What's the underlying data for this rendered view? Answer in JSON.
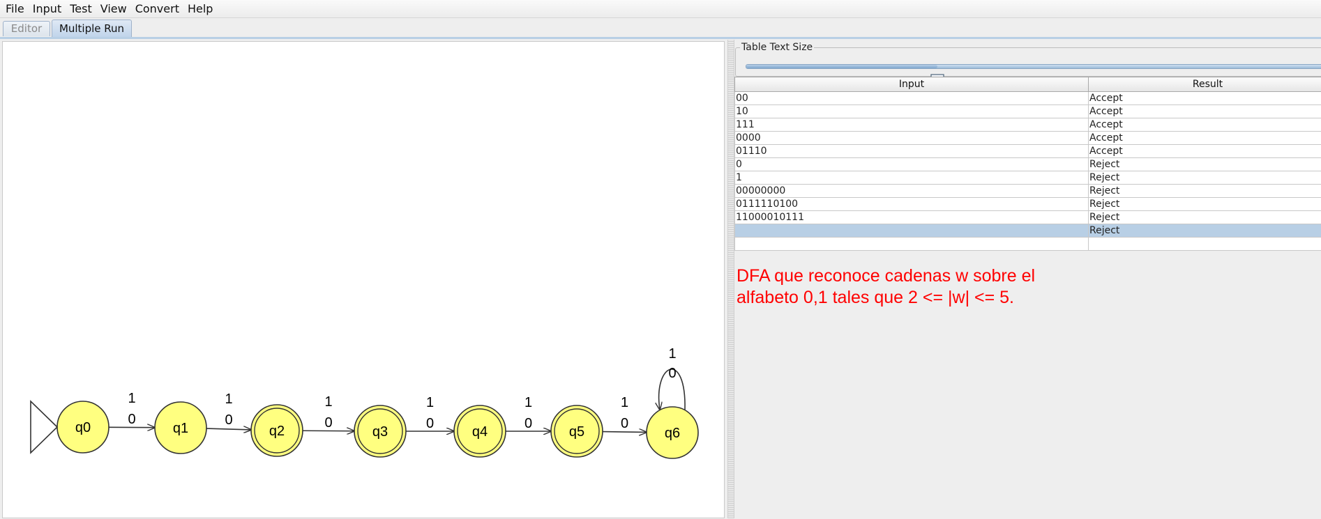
{
  "menu": [
    "File",
    "Input",
    "Test",
    "View",
    "Convert",
    "Help"
  ],
  "tabs": {
    "editor": "Editor",
    "multiple_run": "Multiple Run"
  },
  "table_text_size": {
    "label": "Table Text Size",
    "value_fraction": 0.33
  },
  "table": {
    "headers": {
      "input": "Input",
      "result": "Result"
    },
    "rows": [
      {
        "input": "00",
        "result": "Accept"
      },
      {
        "input": "10",
        "result": "Accept"
      },
      {
        "input": "111",
        "result": "Accept"
      },
      {
        "input": "0000",
        "result": "Accept"
      },
      {
        "input": "01110",
        "result": "Accept"
      },
      {
        "input": "0",
        "result": "Reject"
      },
      {
        "input": "1",
        "result": "Reject"
      },
      {
        "input": "00000000",
        "result": "Reject"
      },
      {
        "input": "0111110100",
        "result": "Reject"
      },
      {
        "input": "11000010111",
        "result": "Reject"
      },
      {
        "input": "",
        "result": "Reject"
      },
      {
        "input": "",
        "result": ""
      }
    ],
    "selected_row": 10
  },
  "description": "DFA que reconoce cadenas w sobre el\nalfabeto 0,1 tales que 2 <= |w| <= 5.",
  "automaton": {
    "initial": "q0",
    "states": [
      {
        "id": "q0",
        "accepting": false
      },
      {
        "id": "q1",
        "accepting": false
      },
      {
        "id": "q2",
        "accepting": true
      },
      {
        "id": "q3",
        "accepting": true
      },
      {
        "id": "q4",
        "accepting": true
      },
      {
        "id": "q5",
        "accepting": true
      },
      {
        "id": "q6",
        "accepting": false
      }
    ],
    "transitions": [
      {
        "from": "q0",
        "to": "q1",
        "labels": [
          "1",
          "0"
        ]
      },
      {
        "from": "q1",
        "to": "q2",
        "labels": [
          "1",
          "0"
        ]
      },
      {
        "from": "q2",
        "to": "q3",
        "labels": [
          "1",
          "0"
        ]
      },
      {
        "from": "q3",
        "to": "q4",
        "labels": [
          "1",
          "0"
        ]
      },
      {
        "from": "q4",
        "to": "q5",
        "labels": [
          "1",
          "0"
        ]
      },
      {
        "from": "q5",
        "to": "q6",
        "labels": [
          "1",
          "0"
        ]
      },
      {
        "from": "q6",
        "to": "q6",
        "labels": [
          "1",
          "0"
        ]
      }
    ],
    "colors": {
      "state_fill": "#ffff80",
      "state_stroke": "#333333",
      "selected_row": "#b8cfe5",
      "description_text": "#ff0000"
    }
  }
}
